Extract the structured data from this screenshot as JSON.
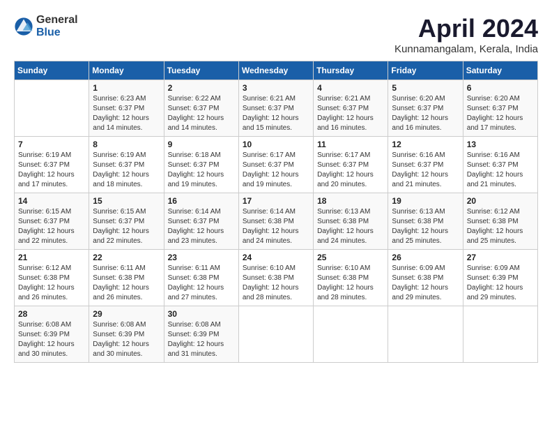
{
  "logo": {
    "general": "General",
    "blue": "Blue"
  },
  "title": "April 2024",
  "location": "Kunnamangalam, Kerala, India",
  "weekdays": [
    "Sunday",
    "Monday",
    "Tuesday",
    "Wednesday",
    "Thursday",
    "Friday",
    "Saturday"
  ],
  "weeks": [
    [
      {
        "day": "",
        "sunrise": "",
        "sunset": "",
        "daylight": ""
      },
      {
        "day": "1",
        "sunrise": "6:23 AM",
        "sunset": "6:37 PM",
        "daylight": "12 hours and 14 minutes."
      },
      {
        "day": "2",
        "sunrise": "6:22 AM",
        "sunset": "6:37 PM",
        "daylight": "12 hours and 14 minutes."
      },
      {
        "day": "3",
        "sunrise": "6:21 AM",
        "sunset": "6:37 PM",
        "daylight": "12 hours and 15 minutes."
      },
      {
        "day": "4",
        "sunrise": "6:21 AM",
        "sunset": "6:37 PM",
        "daylight": "12 hours and 16 minutes."
      },
      {
        "day": "5",
        "sunrise": "6:20 AM",
        "sunset": "6:37 PM",
        "daylight": "12 hours and 16 minutes."
      },
      {
        "day": "6",
        "sunrise": "6:20 AM",
        "sunset": "6:37 PM",
        "daylight": "12 hours and 17 minutes."
      }
    ],
    [
      {
        "day": "7",
        "sunrise": "6:19 AM",
        "sunset": "6:37 PM",
        "daylight": "12 hours and 17 minutes."
      },
      {
        "day": "8",
        "sunrise": "6:19 AM",
        "sunset": "6:37 PM",
        "daylight": "12 hours and 18 minutes."
      },
      {
        "day": "9",
        "sunrise": "6:18 AM",
        "sunset": "6:37 PM",
        "daylight": "12 hours and 19 minutes."
      },
      {
        "day": "10",
        "sunrise": "6:17 AM",
        "sunset": "6:37 PM",
        "daylight": "12 hours and 19 minutes."
      },
      {
        "day": "11",
        "sunrise": "6:17 AM",
        "sunset": "6:37 PM",
        "daylight": "12 hours and 20 minutes."
      },
      {
        "day": "12",
        "sunrise": "6:16 AM",
        "sunset": "6:37 PM",
        "daylight": "12 hours and 21 minutes."
      },
      {
        "day": "13",
        "sunrise": "6:16 AM",
        "sunset": "6:37 PM",
        "daylight": "12 hours and 21 minutes."
      }
    ],
    [
      {
        "day": "14",
        "sunrise": "6:15 AM",
        "sunset": "6:37 PM",
        "daylight": "12 hours and 22 minutes."
      },
      {
        "day": "15",
        "sunrise": "6:15 AM",
        "sunset": "6:37 PM",
        "daylight": "12 hours and 22 minutes."
      },
      {
        "day": "16",
        "sunrise": "6:14 AM",
        "sunset": "6:37 PM",
        "daylight": "12 hours and 23 minutes."
      },
      {
        "day": "17",
        "sunrise": "6:14 AM",
        "sunset": "6:38 PM",
        "daylight": "12 hours and 24 minutes."
      },
      {
        "day": "18",
        "sunrise": "6:13 AM",
        "sunset": "6:38 PM",
        "daylight": "12 hours and 24 minutes."
      },
      {
        "day": "19",
        "sunrise": "6:13 AM",
        "sunset": "6:38 PM",
        "daylight": "12 hours and 25 minutes."
      },
      {
        "day": "20",
        "sunrise": "6:12 AM",
        "sunset": "6:38 PM",
        "daylight": "12 hours and 25 minutes."
      }
    ],
    [
      {
        "day": "21",
        "sunrise": "6:12 AM",
        "sunset": "6:38 PM",
        "daylight": "12 hours and 26 minutes."
      },
      {
        "day": "22",
        "sunrise": "6:11 AM",
        "sunset": "6:38 PM",
        "daylight": "12 hours and 26 minutes."
      },
      {
        "day": "23",
        "sunrise": "6:11 AM",
        "sunset": "6:38 PM",
        "daylight": "12 hours and 27 minutes."
      },
      {
        "day": "24",
        "sunrise": "6:10 AM",
        "sunset": "6:38 PM",
        "daylight": "12 hours and 28 minutes."
      },
      {
        "day": "25",
        "sunrise": "6:10 AM",
        "sunset": "6:38 PM",
        "daylight": "12 hours and 28 minutes."
      },
      {
        "day": "26",
        "sunrise": "6:09 AM",
        "sunset": "6:38 PM",
        "daylight": "12 hours and 29 minutes."
      },
      {
        "day": "27",
        "sunrise": "6:09 AM",
        "sunset": "6:39 PM",
        "daylight": "12 hours and 29 minutes."
      }
    ],
    [
      {
        "day": "28",
        "sunrise": "6:08 AM",
        "sunset": "6:39 PM",
        "daylight": "12 hours and 30 minutes."
      },
      {
        "day": "29",
        "sunrise": "6:08 AM",
        "sunset": "6:39 PM",
        "daylight": "12 hours and 30 minutes."
      },
      {
        "day": "30",
        "sunrise": "6:08 AM",
        "sunset": "6:39 PM",
        "daylight": "12 hours and 31 minutes."
      },
      {
        "day": "",
        "sunrise": "",
        "sunset": "",
        "daylight": ""
      },
      {
        "day": "",
        "sunrise": "",
        "sunset": "",
        "daylight": ""
      },
      {
        "day": "",
        "sunrise": "",
        "sunset": "",
        "daylight": ""
      },
      {
        "day": "",
        "sunrise": "",
        "sunset": "",
        "daylight": ""
      }
    ]
  ],
  "labels": {
    "sunrise_prefix": "Sunrise: ",
    "sunset_prefix": "Sunset: ",
    "daylight_prefix": "Daylight: "
  }
}
